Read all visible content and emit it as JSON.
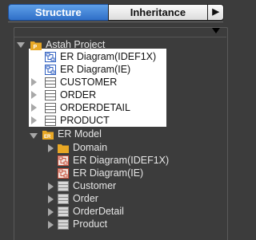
{
  "tabs": {
    "structure": "Structure",
    "inheritance": "Inheritance",
    "more": "▶"
  },
  "tree": {
    "project": "Astah Project",
    "project_items": [
      {
        "label": "ER Diagram(IDEF1X)",
        "icon": "er-diagram-icon"
      },
      {
        "label": "ER Diagram(IE)",
        "icon": "er-diagram-icon"
      },
      {
        "label": "CUSTOMER",
        "icon": "entity-icon"
      },
      {
        "label": "ORDER",
        "icon": "entity-icon"
      },
      {
        "label": "ORDERDETAIL",
        "icon": "entity-icon"
      },
      {
        "label": "PRODUCT",
        "icon": "entity-icon"
      }
    ],
    "er_model": "ER Model",
    "model_items": [
      {
        "label": "Domain",
        "icon": "folder-icon"
      },
      {
        "label": "ER Diagram(IDEF1X)",
        "icon": "er-diagram-icon"
      },
      {
        "label": "ER Diagram(IE)",
        "icon": "er-diagram-icon"
      },
      {
        "label": "Customer",
        "icon": "entity-icon"
      },
      {
        "label": "Order",
        "icon": "entity-icon"
      },
      {
        "label": "OrderDetail",
        "icon": "entity-icon"
      },
      {
        "label": "Product",
        "icon": "entity-icon"
      }
    ]
  },
  "colors": {
    "tab_active": "#3f80d8",
    "highlight_bg": "#ffffff",
    "folder": "#e9a825",
    "diagram_blue": "#2f5fc0",
    "diagram_red": "#c9503c"
  }
}
